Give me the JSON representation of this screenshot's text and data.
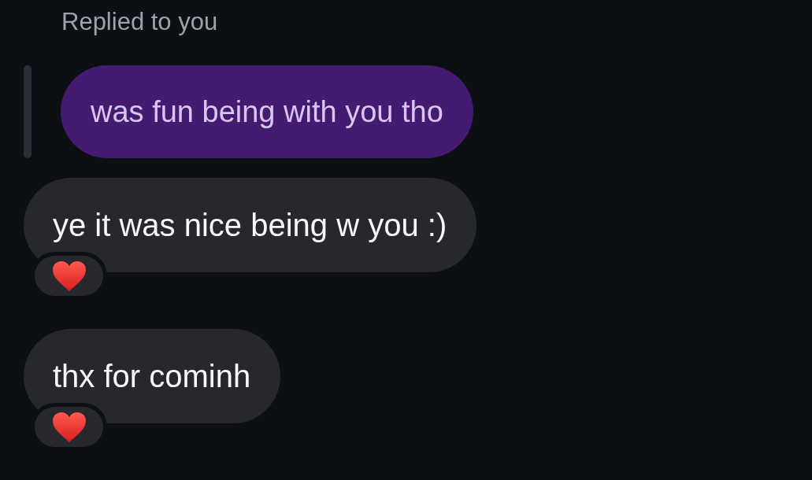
{
  "reply_header": {
    "label": "Replied to you"
  },
  "messages": [
    {
      "kind": "quoted",
      "text": "was fun being with you tho",
      "reacted": false
    },
    {
      "kind": "received",
      "text": "ye it was nice being w you :)",
      "reacted": true
    },
    {
      "kind": "received",
      "text": "thx for cominh",
      "reacted": true
    }
  ]
}
